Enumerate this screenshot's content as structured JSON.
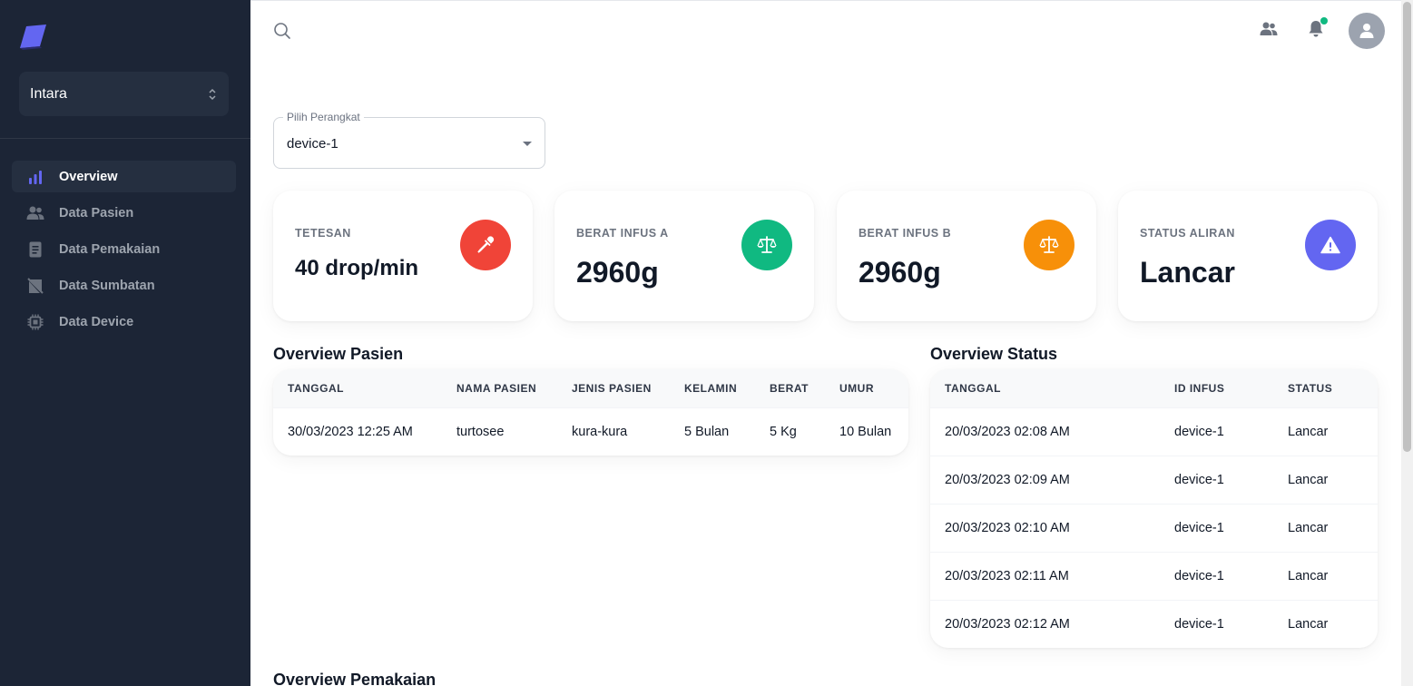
{
  "sidebar": {
    "org_name": "Intara",
    "items": [
      {
        "label": "Overview",
        "icon": "bar-chart-icon",
        "active": true
      },
      {
        "label": "Data Pasien",
        "icon": "users-icon",
        "active": false
      },
      {
        "label": "Data Pemakaian",
        "icon": "document-icon",
        "active": false
      },
      {
        "label": "Data Sumbatan",
        "icon": "blocked-icon",
        "active": false
      },
      {
        "label": "Data Device",
        "icon": "chip-icon",
        "active": false
      }
    ]
  },
  "device_select": {
    "label": "Pilih Perangkat",
    "value": "device-1"
  },
  "cards": [
    {
      "title": "TETESAN",
      "value": "40 drop/min",
      "icon": "dropper-icon",
      "color": "#f04438"
    },
    {
      "title": "BERAT INFUS A",
      "value": "2960g",
      "icon": "scale-icon",
      "color": "#10b981"
    },
    {
      "title": "BERAT INFUS B",
      "value": "2960g",
      "icon": "scale-icon",
      "color": "#f79009"
    },
    {
      "title": "STATUS ALIRAN",
      "value": "Lancar",
      "icon": "warning-icon",
      "color": "#6366f1"
    }
  ],
  "overview_pasien": {
    "title": "Overview Pasien",
    "headers": [
      "TANGGAL",
      "NAMA PASIEN",
      "JENIS PASIEN",
      "KELAMIN",
      "BERAT",
      "UMUR"
    ],
    "rows": [
      [
        "30/03/2023 12:25 AM",
        "turtosee",
        "kura-kura",
        "5 Bulan",
        "5 Kg",
        "10 Bulan"
      ]
    ]
  },
  "overview_status": {
    "title": "Overview Status",
    "headers": [
      "TANGGAL",
      "ID INFUS",
      "STATUS"
    ],
    "rows": [
      [
        "20/03/2023 02:08 AM",
        "device-1",
        "Lancar"
      ],
      [
        "20/03/2023 02:09 AM",
        "device-1",
        "Lancar"
      ],
      [
        "20/03/2023 02:10 AM",
        "device-1",
        "Lancar"
      ],
      [
        "20/03/2023 02:11 AM",
        "device-1",
        "Lancar"
      ],
      [
        "20/03/2023 02:12 AM",
        "device-1",
        "Lancar"
      ]
    ]
  },
  "overview_pemakaian": {
    "title": "Overview Pemakaian"
  },
  "colors": {
    "sidebar_bg": "#1c2536",
    "accent": "#6366f1",
    "notification_dot": "#10b981"
  }
}
